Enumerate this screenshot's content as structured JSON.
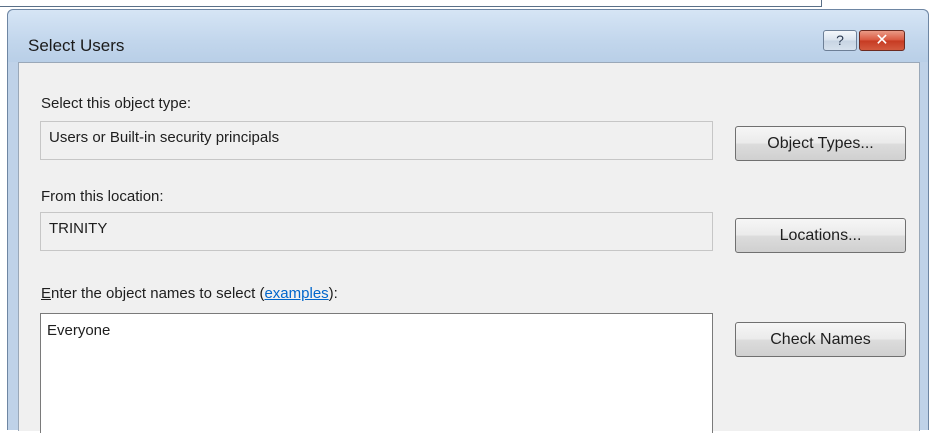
{
  "window": {
    "title": "Select Users",
    "help_glyph": "?",
    "close_glyph": "✕"
  },
  "object_type": {
    "label": "Select this object type:",
    "value": "Users or Built-in security principals",
    "button": "Object Types..."
  },
  "location": {
    "label": "From this location:",
    "value": "TRINITY",
    "button": "Locations..."
  },
  "names": {
    "label_accesskey": "E",
    "label_rest": "nter the object names to select (",
    "link": "examples",
    "label_end": "):",
    "value": "Everyone",
    "button": "Check Names"
  },
  "icons": {
    "help": "help-icon",
    "close": "close-icon"
  },
  "colors": {
    "titlebar": "#c2d6ec",
    "client": "#f0f0f0",
    "link": "#0066cc",
    "close_button": "#c63a22"
  }
}
